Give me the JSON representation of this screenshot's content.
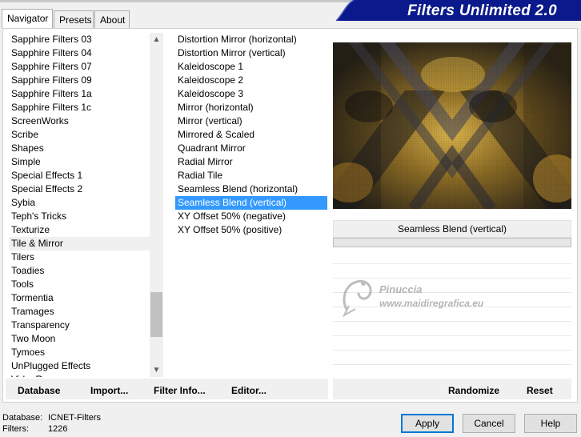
{
  "window": {
    "title": "Filters Unlimited 2.0"
  },
  "tabs": [
    {
      "label": "Navigator",
      "active": true
    },
    {
      "label": "Presets",
      "active": false
    },
    {
      "label": "About",
      "active": false
    }
  ],
  "categories": {
    "items": [
      "Sapphire Filters 03",
      "Sapphire Filters 04",
      "Sapphire Filters 07",
      "Sapphire Filters 09",
      "Sapphire Filters 1a",
      "Sapphire Filters 1c",
      "ScreenWorks",
      "Scribe",
      "Shapes",
      "Simple",
      "Special Effects 1",
      "Special Effects 2",
      "Sybia",
      "Teph's Tricks",
      "Texturize",
      "Tile & Mirror",
      "Tilers",
      "Toadies",
      "Tools",
      "Tormentia",
      "Tramages",
      "Transparency",
      "Two Moon",
      "Tymoes",
      "UnPlugged Effects",
      "VideoRave"
    ],
    "selected_index": 15
  },
  "filters": {
    "items": [
      "Distortion Mirror (horizontal)",
      "Distortion Mirror (vertical)",
      "Kaleidoscope 1",
      "Kaleidoscope 2",
      "Kaleidoscope 3",
      "Mirror (horizontal)",
      "Mirror (vertical)",
      "Mirrored & Scaled",
      "Quadrant Mirror",
      "Radial Mirror",
      "Radial Tile",
      "Seamless Blend (horizontal)",
      "Seamless Blend (vertical)",
      "XY Offset 50% (negative)",
      "XY Offset 50% (positive)"
    ],
    "selected_index": 12
  },
  "left_buttons": {
    "database": "Database",
    "import": "Import...",
    "filter_info": "Filter Info...",
    "editor": "Editor..."
  },
  "preview": {
    "filter_name": "Seamless Blend (vertical)"
  },
  "right_buttons": {
    "randomize": "Randomize",
    "reset": "Reset"
  },
  "watermark": {
    "line1": "Pinuccia",
    "line2": "www.maidiregrafica.eu"
  },
  "status": {
    "database_label": "Database:",
    "database_value": "ICNET-Filters",
    "filters_label": "Filters:",
    "filters_value": "1226"
  },
  "dialog_buttons": {
    "apply": "Apply",
    "cancel": "Cancel",
    "help": "Help"
  },
  "colors": {
    "banner": "#0a1a8c",
    "selection": "#3399ff",
    "accent": "#0078d7"
  }
}
